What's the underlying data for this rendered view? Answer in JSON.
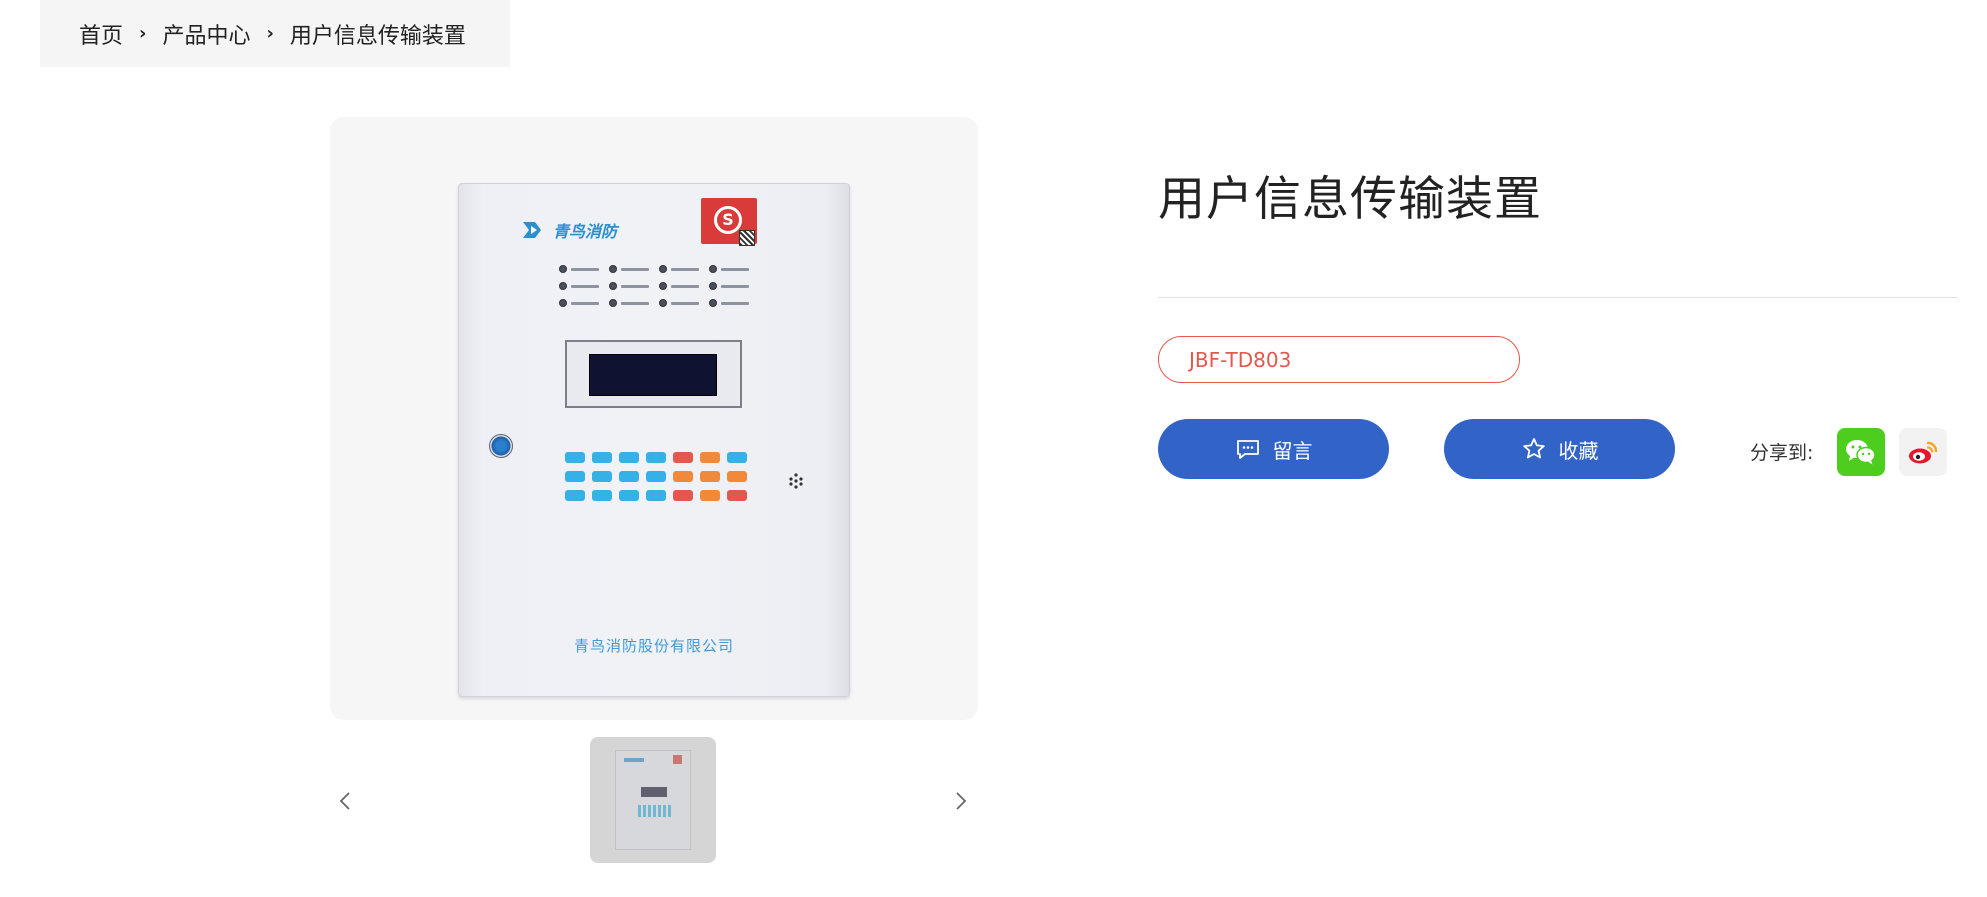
{
  "breadcrumb": {
    "items": [
      "首页",
      "产品中心",
      "用户信息传输装置"
    ]
  },
  "gallery": {
    "device_brand": "青鸟消防",
    "device_company": "青鸟消防股份有限公司",
    "thumbnail_count": 1
  },
  "product": {
    "title": "用户信息传输装置",
    "model": "JBF-TD803"
  },
  "actions": {
    "message_label": "留言",
    "favorite_label": "收藏"
  },
  "share": {
    "label": "分享到:",
    "targets": [
      "wechat",
      "weibo"
    ]
  },
  "colors": {
    "primary": "#3264c8",
    "accent": "#e4574e",
    "wechat": "#4dce1e",
    "weibo": "#e6162d"
  },
  "icons": [
    "chevron-right-icon",
    "chevron-left-icon",
    "message-icon",
    "star-icon",
    "wechat-icon",
    "weibo-icon"
  ]
}
